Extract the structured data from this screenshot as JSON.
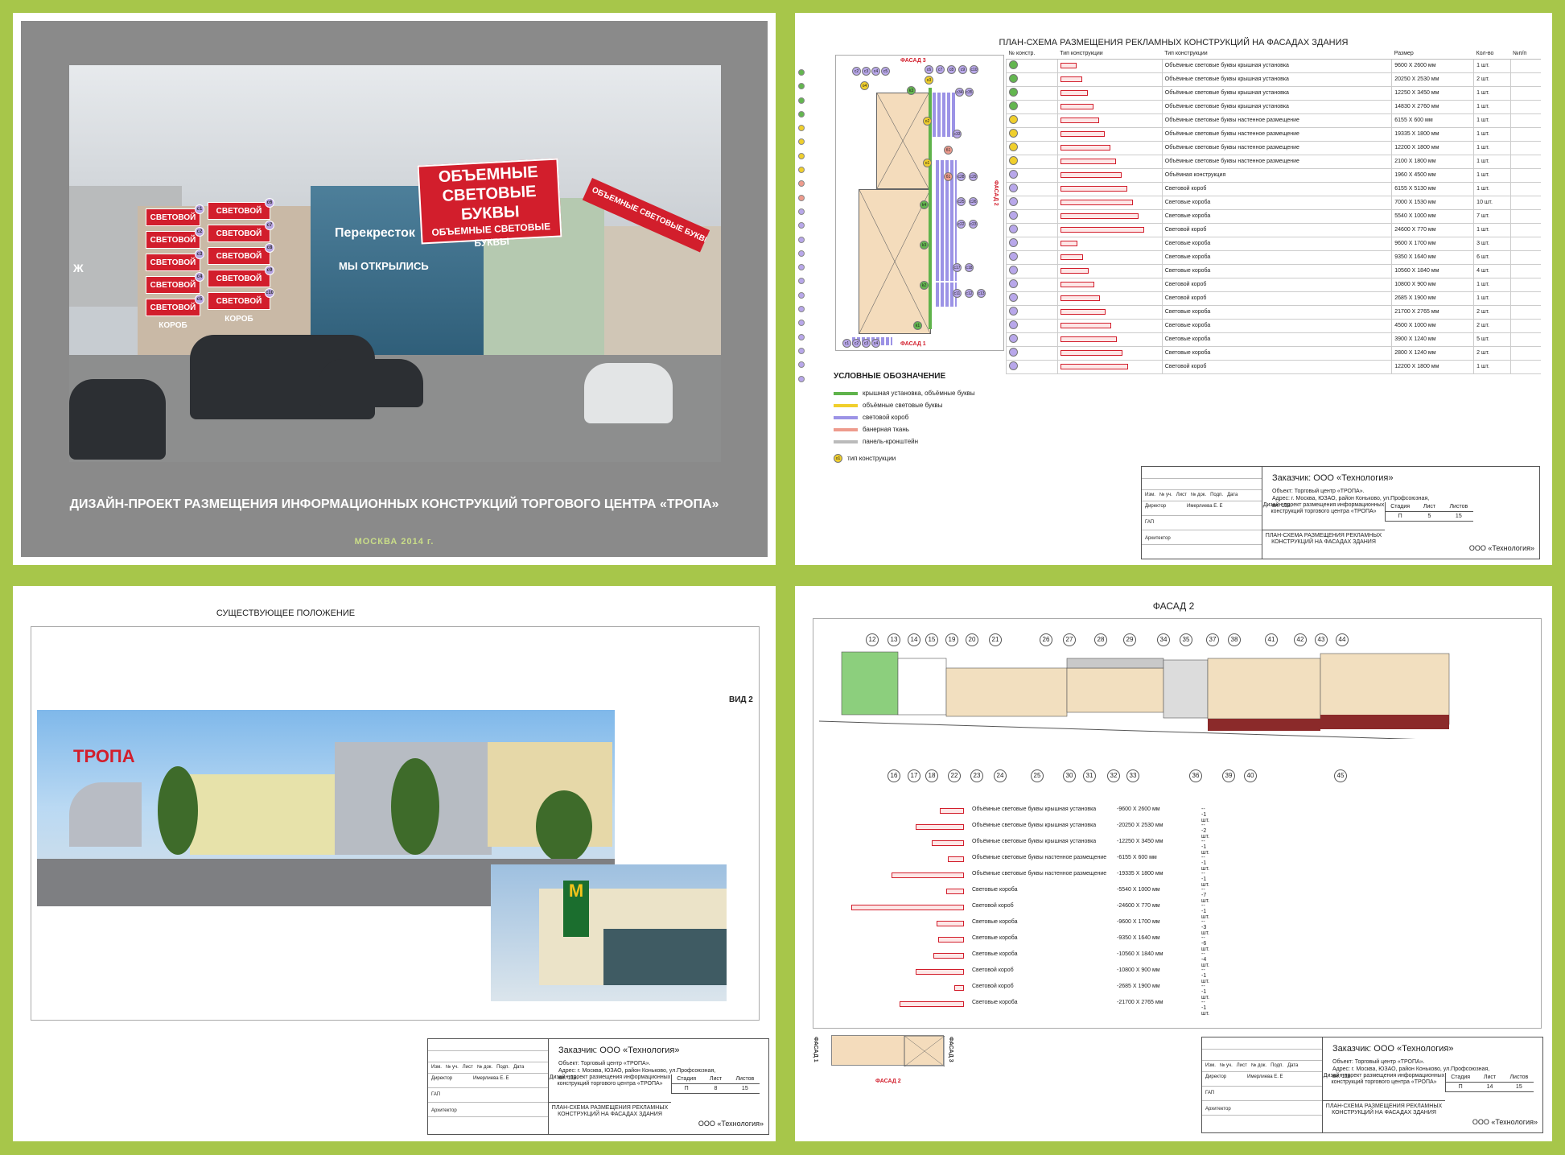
{
  "sheet1": {
    "title": "ДИЗАЙН-ПРОЕКТ РАЗМЕЩЕНИЯ ИНФОРМАЦИОННЫХ КОНСТРУКЦИЙ ТОРГОВОГО ЦЕНТРА «ТРОПА»",
    "subtitle": "МОСКВА 2014 г.",
    "roof_sign": {
      "line1": "ОБЪЕМНЫЕ",
      "line2": "СВЕТОВЫЕ БУКВЫ",
      "line3": "ОБЪЕМНЫЕ СВЕТОВЫЕ БУКВЫ"
    },
    "side_sign": "ОБЪЕМНЫЕ СВЕТОВЫЕ БУКВЫ",
    "box_label": "СВЕТОВОЙ КОРОБ",
    "store_text": "Перекресток",
    "store_text2": "МЫ ОТКРЫЛИСЬ",
    "left_store": "Ж"
  },
  "sheet2": {
    "title": "ПЛАН-СХЕМА РАЗМЕЩЕНИЯ РЕКЛАМНЫХ КОНСТРУКЦИЙ НА ФАСАДАХ ЗДАНИЯ",
    "facade3_label": "ФАСАД 3",
    "facade1_label": "ФАСАД 1",
    "facade2_label": "ФАСАД 2",
    "table_headers": [
      "№ констр.",
      "Тип конструкции",
      "Тип конструкции",
      "Размер",
      "Кол-во",
      "№п/п"
    ],
    "rows": [
      {
        "type": "Объёмные световые буквы крышная установка",
        "size": "9600 Х 2600 мм",
        "qty": "1 шт."
      },
      {
        "type": "Объёмные световые буквы крышная установка",
        "size": "20250 Х 2530 мм",
        "qty": "2 шт."
      },
      {
        "type": "Объёмные световые буквы крышная установка",
        "size": "12250 Х 3450 мм",
        "qty": "1 шт."
      },
      {
        "type": "Объёмные световые буквы крышная установка",
        "size": "14830 Х 2760 мм",
        "qty": "1 шт."
      },
      {
        "type": "Объёмные световые буквы настенное размещение",
        "size": "6155 Х 600 мм",
        "qty": "1 шт."
      },
      {
        "type": "Объёмные световые буквы настенное размещение",
        "size": "19335 Х 1800 мм",
        "qty": "1 шт."
      },
      {
        "type": "Объёмные световые буквы настенное размещение",
        "size": "12200 Х 1800 мм",
        "qty": "1 шт."
      },
      {
        "type": "Объёмные световые буквы настенное размещение",
        "size": "2100 Х 1800 мм",
        "qty": "1 шт."
      },
      {
        "type": "Объёмная конструкция",
        "size": "1960 Х 4500 мм",
        "qty": "1 шт."
      },
      {
        "type": "Световой короб",
        "size": "6155 Х 5130 мм",
        "qty": "1 шт."
      },
      {
        "type": "Световые короба",
        "size": "7000 Х 1530 мм",
        "qty": "10 шт."
      },
      {
        "type": "Световые короба",
        "size": "5540 Х 1000 мм",
        "qty": "7 шт."
      },
      {
        "type": "Световой короб",
        "size": "24600 Х 770 мм",
        "qty": "1 шт."
      },
      {
        "type": "Световые короба",
        "size": "9600 Х 1700 мм",
        "qty": "3 шт."
      },
      {
        "type": "Световые короба",
        "size": "9350 Х 1640 мм",
        "qty": "6 шт."
      },
      {
        "type": "Световые короба",
        "size": "10560 Х 1840 мм",
        "qty": "4 шт."
      },
      {
        "type": "Световой короб",
        "size": "10800 Х 900 мм",
        "qty": "1 шт."
      },
      {
        "type": "Световой короб",
        "size": "2685 Х 1900 мм",
        "qty": "1 шт."
      },
      {
        "type": "Световые короба",
        "size": "21700 Х 2765 мм",
        "qty": "2 шт."
      },
      {
        "type": "Световые короба",
        "size": "4500 Х 1000 мм",
        "qty": "2 шт."
      },
      {
        "type": "Световые короба",
        "size": "3900 Х 1240 мм",
        "qty": "5 шт."
      },
      {
        "type": "Световые короба",
        "size": "2800 Х 1240 мм",
        "qty": "2 шт."
      },
      {
        "type": "Световой короб",
        "size": "12200 Х 1800 мм",
        "qty": "1 шт."
      }
    ],
    "legend": {
      "title": "УСЛОВНЫЕ ОБОЗНАЧЕНИЕ",
      "items": [
        {
          "label": "крышная установка, объёмные буквы",
          "color": "#5fb34b"
        },
        {
          "label": "объёмные световые буквы",
          "color": "#f0cf2c"
        },
        {
          "label": "световой короб",
          "color": "#9c93e6"
        },
        {
          "label": "банерная ткань",
          "color": "#ee9b8d"
        },
        {
          "label": "панель-кронштейн",
          "color": "#bbbbbb"
        }
      ],
      "type_label": "тип конструкции"
    },
    "stamp": {
      "customer": "Заказчик: ООО «Технология»",
      "object": "Объект: Торговый центр «ТРОПА».",
      "address": "Адрес: г. Москва, ЮЗАО, район Коньково, ул.Профсоюзная, вл. 118.",
      "project": "Дизайн-проект размещения информационных конструкций торгового центра «ТРОПА»",
      "plan": "ПЛАН-СХЕМА РАЗМЕЩЕНИЯ РЕКЛАМНЫХ КОНСТРУКЦИЙ НА ФАСАДАХ ЗДАНИЯ",
      "org": "ООО «Технология»",
      "headers": [
        "Изм.",
        "№ уч.",
        "Лист",
        "№ док.",
        "Подп.",
        "Дата"
      ],
      "director": "Директор",
      "director_name": "Имерлиева Е. Е",
      "gap": "ГАП",
      "architect": "Архитектор",
      "stage_label": "Стадия",
      "sheet_label": "Лист",
      "sheets_label": "Листов",
      "stage": "П",
      "sheet": "5",
      "sheets": "15"
    }
  },
  "sheet3": {
    "title": "СУЩЕСТВУЮЩЕЕ ПОЛОЖЕНИЕ",
    "view_label": "ВИД 2",
    "logo": "ТРОПА",
    "mc": "M",
    "stamp_sheet": "8",
    "stamp_sheets": "15"
  },
  "sheet4": {
    "title": "ФАСАД 2",
    "top_numbers": [
      "12",
      "13",
      "14",
      "15",
      "19",
      "20",
      "21",
      "26",
      "27",
      "28",
      "29",
      "34",
      "35",
      "37",
      "38",
      "41",
      "42",
      "43",
      "44"
    ],
    "bottom_numbers": [
      "16",
      "17",
      "18",
      "22",
      "23",
      "24",
      "25",
      "30",
      "31",
      "32",
      "33",
      "36",
      "39",
      "40",
      "45"
    ],
    "signs": [
      {
        "type": "Объёмные световые буквы крышная установка",
        "size": "-9600 Х 2600 мм",
        "qty": "---1 шт.",
        "w": 30
      },
      {
        "type": "Объёмные световые буквы крышная установка",
        "size": "-20250 Х 2530 мм",
        "qty": "---2 шт.",
        "w": 60
      },
      {
        "type": "Объёмные световые буквы крышная установка",
        "size": "-12250 Х 3450 мм",
        "qty": "---1 шт.",
        "w": 40
      },
      {
        "type": "Объёмные световые буквы настенное размещение",
        "size": "-6155 Х 600 мм",
        "qty": "---1 шт.",
        "w": 20
      },
      {
        "type": "Объёмные световые буквы настенное размещение",
        "size": "-19335 Х 1800 мм",
        "qty": "---1 шт.",
        "w": 90
      },
      {
        "type": "Световые короба",
        "size": "-5540 Х 1000 мм",
        "qty": "---7 шт.",
        "w": 22
      },
      {
        "type": "Световой короб",
        "size": "-24600 Х 770 мм",
        "qty": "---1 шт.",
        "w": 140
      },
      {
        "type": "Световые короба",
        "size": "-9600 Х 1700 мм",
        "qty": "---3 шт.",
        "w": 34
      },
      {
        "type": "Световые короба",
        "size": "-9350 Х 1640 мм",
        "qty": "---6 шт.",
        "w": 32
      },
      {
        "type": "Световые короба",
        "size": "-10560 Х 1840 мм",
        "qty": "---4 шт.",
        "w": 38
      },
      {
        "type": "Световой короб",
        "size": "-10800 Х 900 мм",
        "qty": "---1 шт.",
        "w": 60
      },
      {
        "type": "Световой короб",
        "size": "-2685 Х 1900 мм",
        "qty": "---1 шт.",
        "w": 12
      },
      {
        "type": "Световые короба",
        "size": "-21700 Х 2765 мм",
        "qty": "---1 шт.",
        "w": 80
      }
    ],
    "facade1": "ФАСАД 1",
    "facade2": "ФАСАД 2",
    "facade3": "ФАСАД 3",
    "stamp_sheet": "14",
    "stamp_sheets": "15"
  },
  "colors": {
    "accent": "#a7c64a",
    "sign_red": "#d21e2c"
  }
}
